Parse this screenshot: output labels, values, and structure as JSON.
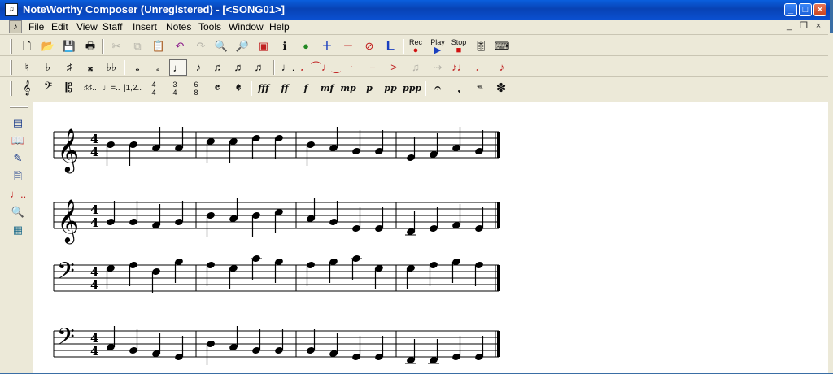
{
  "titlebar": {
    "title": "NoteWorthy Composer (Unregistered) - [<SONG01>]"
  },
  "menu": [
    "File",
    "Edit",
    "View",
    "Staff",
    "Insert",
    "Notes",
    "Tools",
    "Window",
    "Help"
  ],
  "toolbar_main": {
    "buttons": [
      "new-icon",
      "open-icon",
      "save-icon",
      "print-icon",
      "cut-icon",
      "copy-icon",
      "paste-icon",
      "undo-icon",
      "redo-icon",
      "zoom-in-icon",
      "zoom-out-icon",
      "layers-icon",
      "info-icon",
      "globe-icon",
      "plus-icon",
      "minus-icon",
      "stop-sign-icon",
      "layout-icon"
    ],
    "rec_label": "Rec",
    "play_label": "Play",
    "stop_label": "Stop"
  },
  "toolbar_notes": {
    "buttons": [
      "natural-icon",
      "flat-icon",
      "sharp-icon",
      "double-sharp-icon",
      "double-flat-icon",
      "whole-note-icon",
      "half-note-icon",
      "quarter-note-icon",
      "eighth-note-icon",
      "sixteenth-note-icon",
      "thirty-second-note-icon",
      "sixty-fourth-note-icon",
      "dotted-icon",
      "tie-icon",
      "slur-icon",
      "staccato-icon",
      "tenuto-icon",
      "accent-icon",
      "grace-icon",
      "triplet-icon",
      "chord-icon",
      "beam-icon",
      "stem-icon"
    ]
  },
  "toolbar_staff": {
    "time_labels": [
      "4",
      "4",
      "3",
      "4",
      "6",
      "8"
    ],
    "dynamics": [
      "fff",
      "ff",
      "f",
      "mf",
      "mp",
      "p",
      "pp",
      "ppp"
    ]
  },
  "score": {
    "systems": [
      {
        "clef": "treble",
        "time": [
          "4",
          "4"
        ]
      },
      {
        "clef": "treble",
        "time": [
          "4",
          "4"
        ]
      },
      {
        "clef": "bass",
        "time": [
          "4",
          "4"
        ]
      },
      {
        "clef": "bass",
        "time": [
          "4",
          "4"
        ]
      }
    ]
  }
}
